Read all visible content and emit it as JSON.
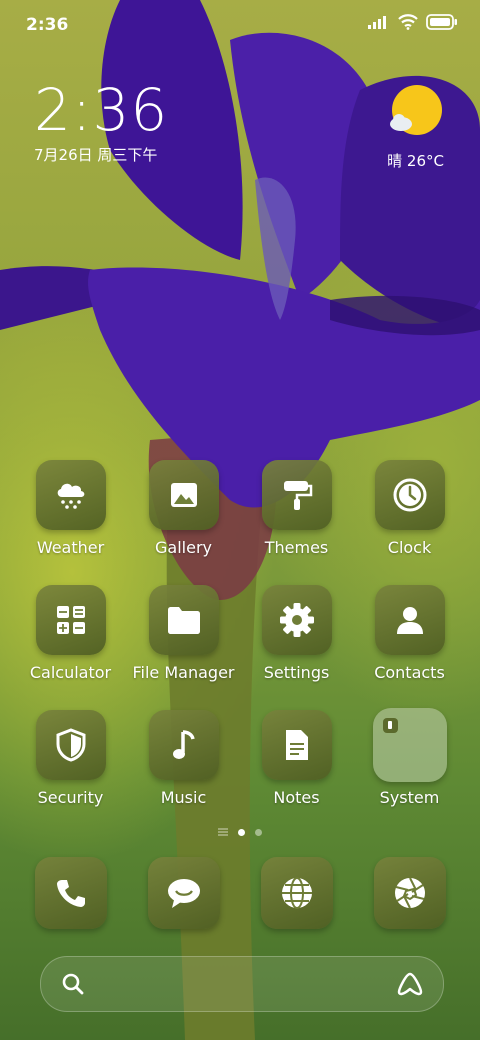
{
  "status_bar": {
    "time": "2:36",
    "icons": [
      "signal-icon",
      "wifi-icon",
      "battery-icon"
    ]
  },
  "clock_widget": {
    "time": "2:36",
    "date": "7月26日 周三下午"
  },
  "weather_widget": {
    "icon": "partly-sunny-icon",
    "text": "晴 26°C"
  },
  "apps": [
    {
      "name": "weather",
      "label": "Weather",
      "icon": "cloud-snow-icon"
    },
    {
      "name": "gallery",
      "label": "Gallery",
      "icon": "image-icon"
    },
    {
      "name": "themes",
      "label": "Themes",
      "icon": "paint-roller-icon"
    },
    {
      "name": "clock",
      "label": "Clock",
      "icon": "clock-icon"
    },
    {
      "name": "calculator",
      "label": "Calculator",
      "icon": "calculator-icon"
    },
    {
      "name": "file-manager",
      "label": "File Manager",
      "icon": "folder-icon"
    },
    {
      "name": "settings",
      "label": "Settings",
      "icon": "gear-icon"
    },
    {
      "name": "contacts",
      "label": "Contacts",
      "icon": "person-icon"
    },
    {
      "name": "security",
      "label": "Security",
      "icon": "shield-icon"
    },
    {
      "name": "music",
      "label": "Music",
      "icon": "music-note-icon"
    },
    {
      "name": "notes",
      "label": "Notes",
      "icon": "document-icon"
    },
    {
      "name": "system",
      "label": "System",
      "icon": "folder-grid-icon"
    }
  ],
  "dock": [
    {
      "name": "phone",
      "icon": "phone-icon"
    },
    {
      "name": "messages",
      "icon": "chat-bubble-icon"
    },
    {
      "name": "browser",
      "icon": "globe-icon"
    },
    {
      "name": "camera",
      "icon": "aperture-icon"
    }
  ],
  "search_bar": {
    "left_icon": "search-icon",
    "right_icon": "assistant-icon"
  },
  "colors": {
    "icon_bg": "#6f7d37",
    "weather_sun": "#f7c61a",
    "flower": "#4a1fa0"
  }
}
